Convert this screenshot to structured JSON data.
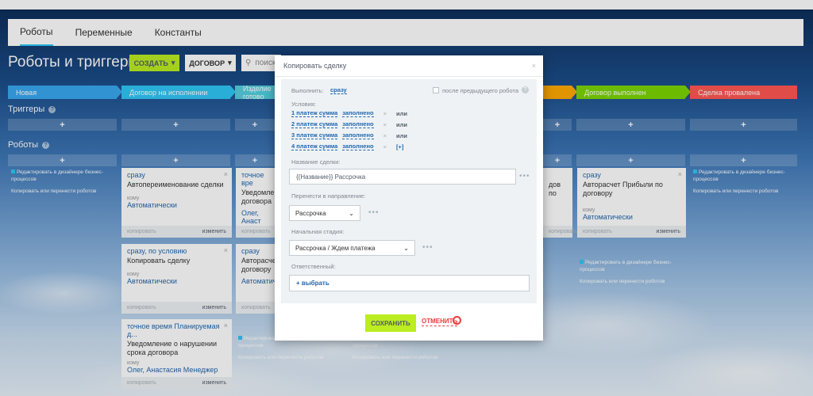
{
  "tabs": [
    "Роботы",
    "Переменные",
    "Константы"
  ],
  "page_title": "Роботы и триггеры",
  "toolbar": {
    "create_label": "СОЗДАТЬ",
    "contract_label": "ДОГОВОР",
    "search_placeholder": "поиск"
  },
  "stages": [
    {
      "label": "Новая",
      "color": "#39a8ef"
    },
    {
      "label": "Договор на исполнении",
      "color": "#2fc6f6"
    },
    {
      "label": "Изделие готово",
      "color": "#55d0e0"
    },
    {
      "label": "",
      "color": "#47e4c2"
    },
    {
      "label": "",
      "color": "#ffa900"
    },
    {
      "label": "Договор выполнен",
      "color": "#7bd500"
    },
    {
      "label": "Сделка провалена",
      "color": "#ff5752"
    }
  ],
  "sections": {
    "triggers": "Триггеры",
    "robots": "Роботы",
    "help": "?"
  },
  "add_symbol": "+",
  "aux": {
    "edit_designer": "Редактировать в дизайнере бизнес-процессов",
    "copy_move": "Копировать или перенести роботов"
  },
  "card_labels": {
    "komu": "кому",
    "copy": "копировать",
    "edit": "изменить",
    "close": "×"
  },
  "cards": [
    {
      "when": "сразу",
      "title": "Автопереименование сделки",
      "who": "Автоматически"
    },
    {
      "when": "сразу, по условию",
      "title": "Копировать сделку",
      "who": "Автоматически"
    },
    {
      "when": "точное время Планируемая д...",
      "title": "Уведомление о нарушении срока договора",
      "who": "Олег, Анастасия Менеджер"
    },
    {
      "when": "точное вре",
      "title": "Уведомлени договора",
      "who": "Олег, Анаст"
    },
    {
      "when": "сразу",
      "title": "Авторасчет договору",
      "who": "Автоматиче"
    },
    {
      "when": "",
      "title": "дов по",
      "who": ""
    },
    {
      "when": "сразу",
      "title": "Авторасчет Прибыли по договору",
      "who": "Автоматически"
    },
    {
      "when": "сразу",
      "title": "Автопереименование сделки",
      "who": "Автоматически"
    }
  ],
  "modal": {
    "title": "Копировать сделку",
    "close": "×",
    "execute_label": "Выполнить:",
    "execute_value": "сразу",
    "after_prev_label": "после предыдущего робота",
    "conditions_label": "Условия:",
    "conditions": [
      {
        "field": "1 платеж сумма",
        "value": "заполнено",
        "op": "или"
      },
      {
        "field": "2 платеж сумма",
        "value": "заполнено",
        "op": "или"
      },
      {
        "field": "3 платеж сумма",
        "value": "заполнено",
        "op": "или"
      },
      {
        "field": "4 платеж сумма",
        "value": "заполнено",
        "op": "[+]"
      }
    ],
    "delete_symbol": "×",
    "deal_name_label": "Название сделки:",
    "deal_name_value": "{{Название}} Рассрочка",
    "direction_label": "Перенести в направление:",
    "direction_value": "Рассрочка",
    "stage_label": "Начальная стадия:",
    "stage_value": "Рассрочка / Ждем платежа",
    "responsible_label": "Ответственный:",
    "responsible_value": "+ выбрать",
    "dots": "•••",
    "save": "СОХРАНИТЬ",
    "cancel": "ОТМЕНИТЬ"
  }
}
